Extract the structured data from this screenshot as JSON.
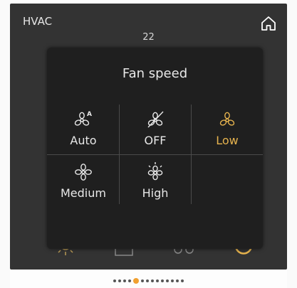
{
  "header": {
    "title": "HVAC",
    "setpoint": "22"
  },
  "fan_panel": {
    "title": "Fan speed",
    "options": [
      {
        "label": "Auto",
        "icon": "fan-auto-icon",
        "selected": false
      },
      {
        "label": "OFF",
        "icon": "fan-off-icon",
        "selected": false
      },
      {
        "label": "Low",
        "icon": "fan-low-icon",
        "selected": true
      },
      {
        "label": "Medium",
        "icon": "fan-medium-icon",
        "selected": false
      },
      {
        "label": "High",
        "icon": "fan-high-icon",
        "selected": false
      }
    ]
  },
  "pagination": {
    "current_page": 5,
    "total_pages": 14
  },
  "colors": {
    "accent": "#e5b24e",
    "text": "#e8e8e8",
    "panel": "#1f1f1f",
    "screen": "#333333"
  }
}
